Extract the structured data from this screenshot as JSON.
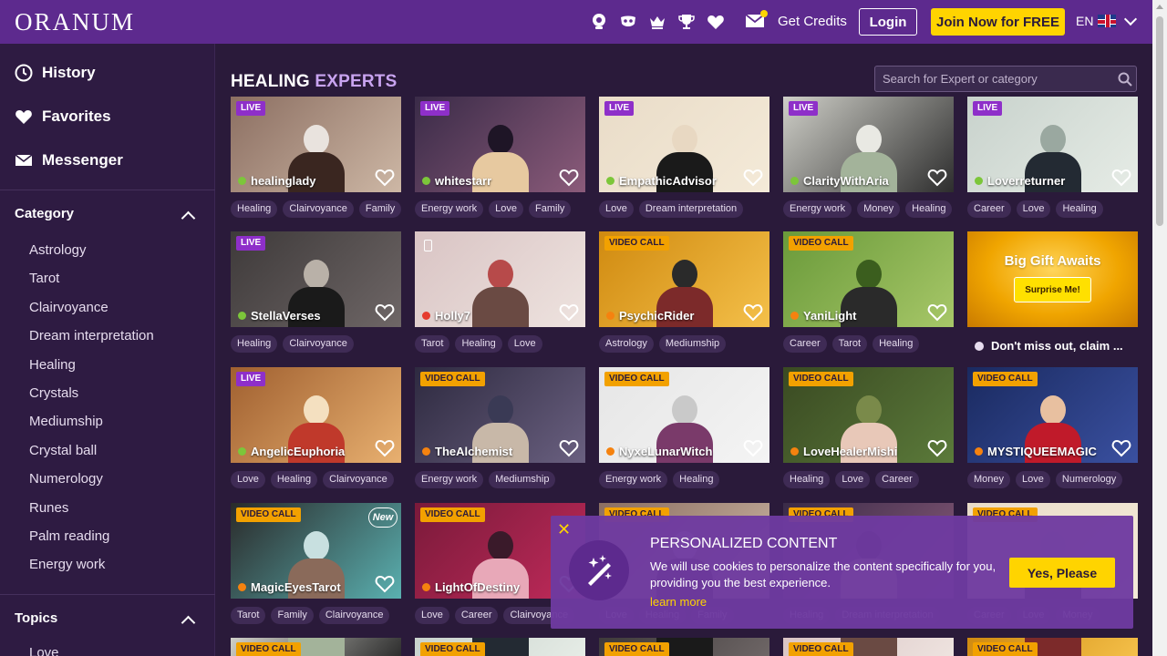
{
  "header": {
    "logo": "ORANUM",
    "get_credits": "Get Credits",
    "login": "Login",
    "join": "Join Now for FREE",
    "lang": "EN",
    "icons": [
      "eye-icon",
      "mask-icon",
      "crown-icon",
      "trophy-icon",
      "heart-icon",
      "mail-icon"
    ]
  },
  "sidebar": {
    "history": "History",
    "favorites": "Favorites",
    "messenger": "Messenger",
    "category_title": "Category",
    "categories": [
      "Astrology",
      "Tarot",
      "Clairvoyance",
      "Dream interpretation",
      "Healing",
      "Crystals",
      "Mediumship",
      "Crystal ball",
      "Numerology",
      "Runes",
      "Palm reading",
      "Energy work"
    ],
    "topics_title": "Topics",
    "topics": [
      "Love"
    ]
  },
  "main": {
    "title_a": "HEALING",
    "title_b": "EXPERTS",
    "search_placeholder": "Search for Expert or category"
  },
  "colors": {
    "header": "#5d2a8e",
    "accent_yellow": "#ffd400",
    "live_badge": "#8e2fc9",
    "video_badge": "#f2a100",
    "status_green": "#7cc63a",
    "status_orange": "#f5820f",
    "status_red": "#e53b2f"
  },
  "experts": [
    {
      "name": "healinglady",
      "badge": "LIVE",
      "status": "green",
      "tags": [
        "Healing",
        "Clairvoyance",
        "Family"
      ]
    },
    {
      "name": "whitestarr",
      "badge": "LIVE",
      "status": "green",
      "tags": [
        "Energy work",
        "Love",
        "Family"
      ]
    },
    {
      "name": "EmpathicAdvisor",
      "badge": "LIVE",
      "status": "green",
      "tags": [
        "Love",
        "Dream interpretation"
      ]
    },
    {
      "name": "ClarityWithAria",
      "badge": "LIVE",
      "status": "green",
      "tags": [
        "Energy work",
        "Money",
        "Healing"
      ]
    },
    {
      "name": "Loverreturner",
      "badge": "LIVE",
      "status": "green",
      "tags": [
        "Career",
        "Love",
        "Healing"
      ]
    },
    {
      "name": "StellaVerses",
      "badge": "LIVE",
      "status": "green",
      "tags": [
        "Healing",
        "Clairvoyance"
      ]
    },
    {
      "name": "Holly7",
      "badge": "",
      "status": "red",
      "tags": [
        "Tarot",
        "Healing",
        "Love"
      ]
    },
    {
      "name": "PsychicRider",
      "badge": "VIDEO CALL",
      "status": "orange",
      "tags": [
        "Astrology",
        "Mediumship"
      ]
    },
    {
      "name": "YaniLight",
      "badge": "VIDEO CALL",
      "status": "orange",
      "tags": [
        "Career",
        "Tarot",
        "Healing"
      ]
    },
    {
      "name": "AngelicEuphoria",
      "badge": "LIVE",
      "status": "green",
      "tags": [
        "Love",
        "Healing",
        "Clairvoyance"
      ]
    },
    {
      "name": "TheAlchemist",
      "badge": "VIDEO CALL",
      "status": "orange",
      "tags": [
        "Energy work",
        "Mediumship"
      ]
    },
    {
      "name": "NyxeLunarWitch",
      "badge": "VIDEO CALL",
      "status": "orange",
      "tags": [
        "Energy work",
        "Healing"
      ]
    },
    {
      "name": "LoveHealerMishi",
      "badge": "VIDEO CALL",
      "status": "orange",
      "tags": [
        "Healing",
        "Love",
        "Career"
      ]
    },
    {
      "name": "MYSTIQUEEMAGIC",
      "badge": "VIDEO CALL",
      "status": "orange",
      "tags": [
        "Money",
        "Love",
        "Numerology"
      ]
    },
    {
      "name": "MagicEyesTarot",
      "badge": "VIDEO CALL",
      "status": "orange",
      "tags": [
        "Tarot",
        "Family",
        "Clairvoyance"
      ],
      "new": "New"
    },
    {
      "name": "LightOfDestiny",
      "badge": "VIDEO CALL",
      "status": "orange",
      "tags": [
        "Love",
        "Career",
        "Clairvoyance"
      ]
    },
    {
      "name": "",
      "badge": "VIDEO CALL",
      "status": "orange",
      "tags": [
        "Love",
        "Healing",
        "Family"
      ]
    },
    {
      "name": "",
      "badge": "VIDEO CALL",
      "status": "orange",
      "tags": [
        "Healing",
        "Dream interpretation"
      ]
    },
    {
      "name": "",
      "badge": "VIDEO CALL",
      "status": "orange",
      "tags": [
        "Career",
        "Love",
        "Money"
      ]
    },
    {
      "name": "",
      "badge": "VIDEO CALL",
      "status": "",
      "tags": []
    },
    {
      "name": "",
      "badge": "VIDEO CALL",
      "status": "",
      "tags": []
    },
    {
      "name": "",
      "badge": "VIDEO CALL",
      "status": "",
      "tags": []
    },
    {
      "name": "",
      "badge": "VIDEO CALL",
      "status": "",
      "tags": []
    },
    {
      "name": "",
      "badge": "VIDEO CALL",
      "status": "",
      "tags": []
    }
  ],
  "promo": {
    "title": "Big Gift Awaits",
    "button": "Surprise Me!",
    "caption": "Don't miss out, claim ..."
  },
  "cookie": {
    "close": "✕",
    "title": "PERSONALIZED CONTENT",
    "text": "We will use cookies to personalize the content specifically for you, providing you the best experience.",
    "link": "learn more",
    "button": "Yes, Please"
  }
}
